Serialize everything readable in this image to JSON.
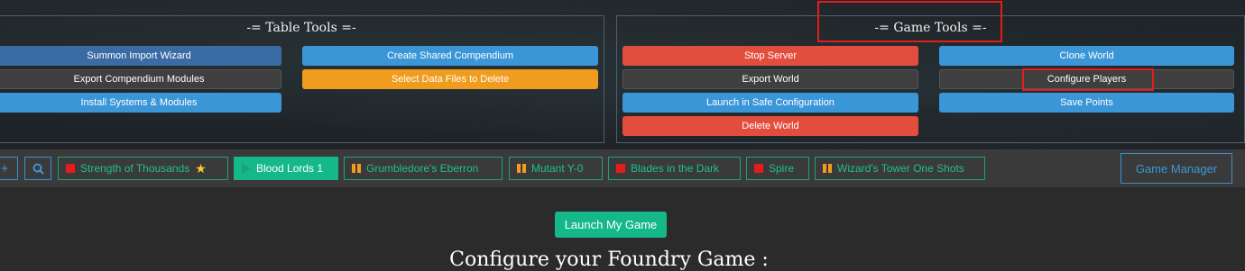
{
  "table_tools": {
    "title": "-= Table Tools =-",
    "buttons": {
      "summon_import": "Summon Import Wizard",
      "export_compendium": "Export Compendium Modules",
      "install_systems": "Install Systems & Modules",
      "create_shared": "Create Shared Compendium",
      "select_data_files": "Select Data Files to Delete"
    }
  },
  "game_tools": {
    "title": "-= Game Tools =-",
    "buttons": {
      "stop_server": "Stop Server",
      "export_world": "Export World",
      "launch_safe": "Launch in Safe Configuration",
      "delete_world": "Delete World",
      "clone_world": "Clone World",
      "configure_players": "Configure Players",
      "save_points": "Save Points"
    }
  },
  "tabbar": {
    "add_label": "+",
    "search_label": "🔍",
    "games": [
      {
        "label": "Strength of Thousands",
        "icon": "red-square-icon",
        "starred": true
      },
      {
        "label": "Blood Lords 1",
        "icon": "play-icon",
        "active": true
      },
      {
        "label": "Grumbledore's Eberron",
        "icon": "pause-icon"
      },
      {
        "label": "Mutant Y-0",
        "icon": "pause-icon"
      },
      {
        "label": "Blades in the Dark",
        "icon": "red-square-icon"
      },
      {
        "label": "Spire",
        "icon": "red-square-icon"
      },
      {
        "label": "Wizard's Tower One Shots",
        "icon": "pause-icon"
      }
    ],
    "star_glyph": "★",
    "game_manager": "Game Manager"
  },
  "main": {
    "launch_button": "Launch My Game",
    "title": "Configure your Foundry Game :"
  },
  "colors": {
    "accent_green": "#15b989",
    "accent_blue": "#3b96d8",
    "danger_red": "#e34d3e",
    "warning_orange": "#f09c1e"
  }
}
